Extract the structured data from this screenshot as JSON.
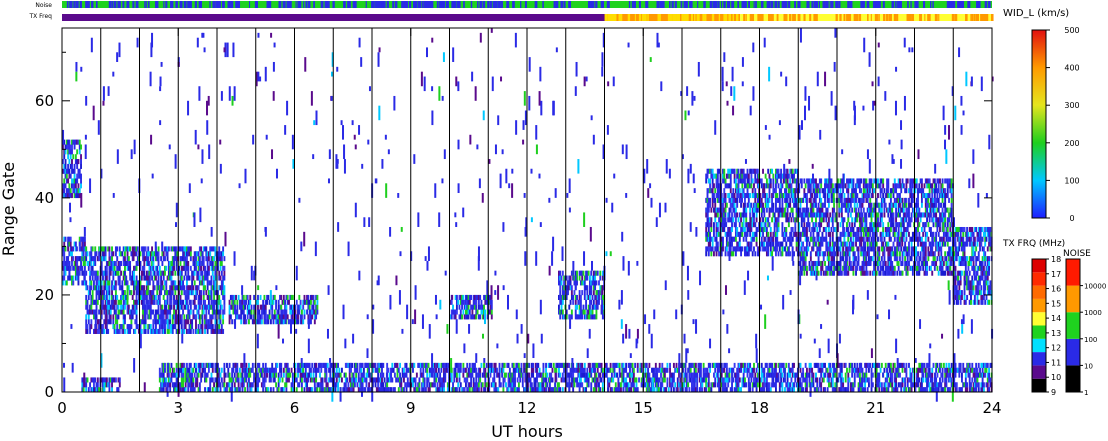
{
  "chart_data": {
    "type": "heatmap",
    "xlabel": "UT hours",
    "ylabel": "Range Gate",
    "xlim": [
      0,
      24
    ],
    "ylim": [
      0,
      75
    ],
    "x_ticks": [
      0,
      3,
      6,
      9,
      12,
      15,
      18,
      21,
      24
    ],
    "x_tick_labels": [
      "0",
      "3",
      "6",
      "9",
      "12",
      "15",
      "18",
      "21",
      "24"
    ],
    "y_ticks": [
      0,
      20,
      40,
      60
    ],
    "y_tick_labels": [
      "0",
      "20",
      "40",
      "60"
    ],
    "hour_gridlines": [
      1,
      2,
      3,
      4,
      5,
      6,
      7,
      8,
      9,
      10,
      11,
      12,
      13,
      14,
      15,
      16,
      17,
      18,
      19,
      20,
      21,
      22,
      23
    ],
    "grid": true,
    "top_strips": {
      "noise_label": "Noise",
      "txfreq_label": "TX Freq",
      "noise_segments": [
        {
          "x0": 0,
          "x1": 14,
          "color": "#1fd21f",
          "mixed_with": "#2a2ae6"
        },
        {
          "x0": 14,
          "x1": 24,
          "color": "#1fd21f",
          "mixed_with": "#2a2ae6"
        }
      ],
      "txfreq_segments": [
        {
          "x0": 0,
          "x1": 14,
          "color": "#5a0a8c"
        },
        {
          "x0": 14,
          "x1": 17.5,
          "color": "#ff9900",
          "mixed_with": "#ffdd00"
        },
        {
          "x0": 17.5,
          "x1": 24,
          "color": "#ffff33",
          "mixed_with": "#ff9900"
        }
      ]
    },
    "echo_regions": [
      {
        "x": [
          0.0,
          0.5
        ],
        "gates": [
          40,
          52
        ],
        "dominant_color": "#2a2ae6"
      },
      {
        "x": [
          0.0,
          0.6
        ],
        "gates": [
          22,
          32
        ],
        "dominant_color": "#2a2ae6"
      },
      {
        "x": [
          0.6,
          4.2
        ],
        "gates": [
          12,
          30
        ],
        "dominant_color": "#2a2ae6"
      },
      {
        "x": [
          4.3,
          6.6
        ],
        "gates": [
          14,
          20
        ],
        "dominant_color": "#2a2ae6"
      },
      {
        "x": [
          10.0,
          11.1
        ],
        "gates": [
          15,
          20
        ],
        "dominant_color": "#2a2ae6"
      },
      {
        "x": [
          12.8,
          14.0
        ],
        "gates": [
          15,
          25
        ],
        "dominant_color": "#2a2ae6"
      },
      {
        "x": [
          16.6,
          19.0
        ],
        "gates": [
          28,
          46
        ],
        "dominant_color": "#2a2ae6"
      },
      {
        "x": [
          19.0,
          23.0
        ],
        "gates": [
          24,
          44
        ],
        "dominant_color": "#2a2ae6"
      },
      {
        "x": [
          23.0,
          24.0
        ],
        "gates": [
          18,
          34
        ],
        "dominant_color": "#2a2ae6"
      },
      {
        "x": [
          2.5,
          24.0
        ],
        "gates": [
          0,
          6
        ],
        "dominant_color": "#2a2ae6"
      },
      {
        "x": [
          0.5,
          1.5
        ],
        "gates": [
          0,
          3
        ],
        "dominant_color": "#2a2ae6"
      }
    ],
    "colorbars": [
      {
        "title": "WID_L (km/s)",
        "min": 0,
        "max": 500,
        "tick_labels": [
          "0",
          "100",
          "200",
          "300",
          "400",
          "500"
        ],
        "colors": [
          "#1e1eff",
          "#00c8ff",
          "#1ecf1e",
          "#e5e51e",
          "#ff9a00",
          "#e11010"
        ]
      },
      {
        "title": "TX FRQ (MHz)",
        "tick_labels": [
          "9",
          "10",
          "11",
          "12",
          "13",
          "14",
          "15",
          "16",
          "17",
          "18"
        ],
        "colors": [
          "#000000",
          "#5a0a8c",
          "#2a2ae6",
          "#00e0ff",
          "#1fd21f",
          "#ffff33",
          "#ff9900",
          "#ff6a00",
          "#ff2a00",
          "#dd0000"
        ]
      },
      {
        "title": "NOISE",
        "tick_labels": [
          "1",
          "10",
          "100",
          "1000",
          "10000"
        ],
        "colors": [
          "#000000",
          "#2a2ae6",
          "#1fd21f",
          "#ff9900",
          "#ff1a00"
        ]
      }
    ]
  }
}
